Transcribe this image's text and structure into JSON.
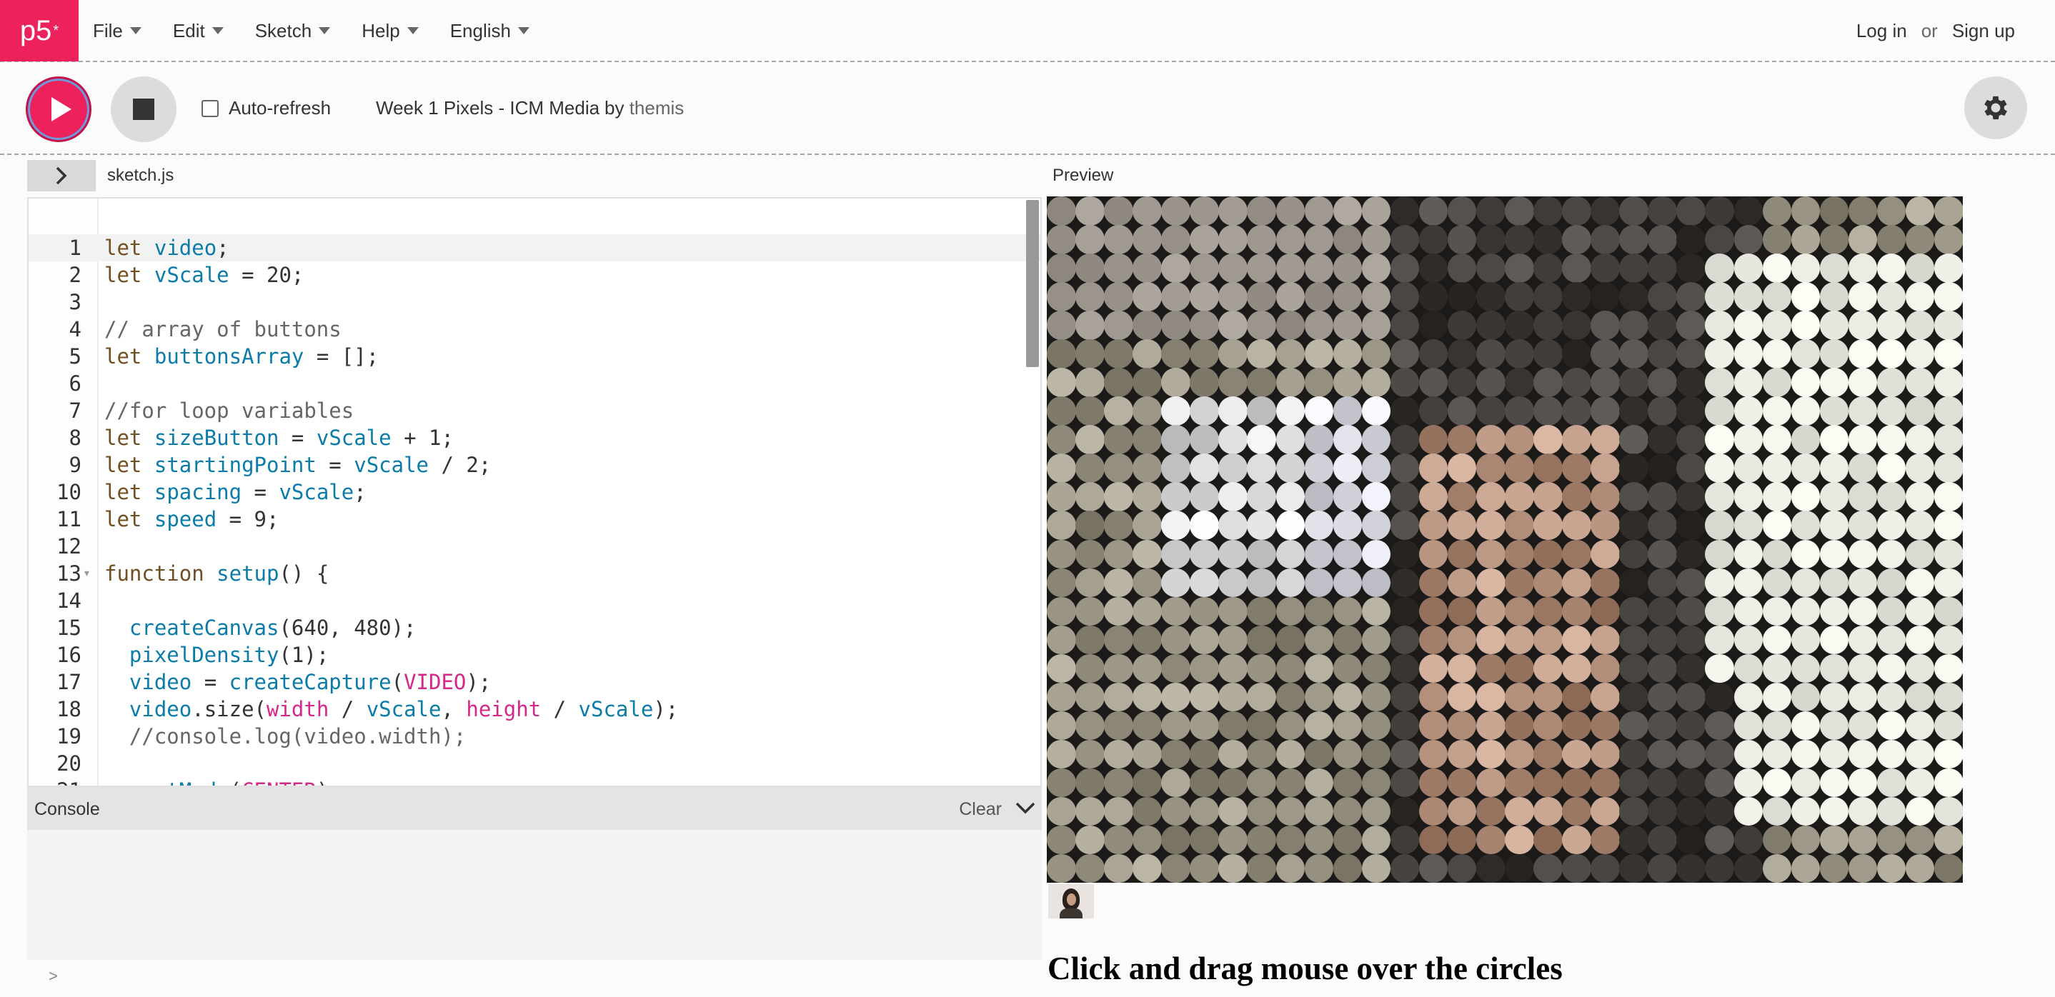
{
  "nav": {
    "logo": "p5",
    "logo_mark": "*",
    "menu": [
      "File",
      "Edit",
      "Sketch",
      "Help",
      "English"
    ],
    "login": "Log in",
    "or": "or",
    "signup": "Sign up"
  },
  "toolbar": {
    "auto_refresh_label": "Auto-refresh",
    "auto_refresh_checked": false,
    "sketch_name": "Week 1 Pixels - ICM Media",
    "by": "by",
    "author": "themis"
  },
  "editor": {
    "file_name": "sketch.js",
    "active_line": 1,
    "lines": [
      "let video;",
      "let vScale = 20;",
      "",
      "// array of buttons",
      "let buttonsArray = [];",
      "",
      "//for loop variables",
      "let sizeButton = vScale + 1;",
      "let startingPoint = vScale / 2;",
      "let spacing = vScale;",
      "let speed = 9;",
      "",
      "function setup() {",
      "",
      "  createCanvas(640, 480);",
      "  pixelDensity(1);",
      "  video = createCapture(VIDEO);",
      "  video.size(width / vScale, height / vScale);",
      "  //console.log(video.width);",
      "",
      "  rectMode(CENTER);"
    ]
  },
  "console": {
    "label": "Console",
    "clear_label": "Clear",
    "prompt": ">"
  },
  "preview": {
    "label": "Preview",
    "caption": "Click and drag mouse over the circles",
    "grid_cols": 32,
    "grid_rows": 24
  },
  "colors": {
    "brand": "#ed225d",
    "keyword": "#704f21",
    "variable": "#0b7ca9",
    "builtin": "#d52889",
    "comment": "#666666"
  },
  "icons": {
    "play": "play-icon",
    "stop": "stop-icon",
    "settings": "gear-icon",
    "collapse": "chevron-right-icon",
    "console_toggle": "chevron-down-icon"
  }
}
